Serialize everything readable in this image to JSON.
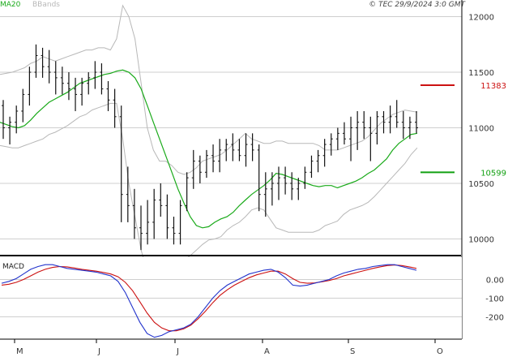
{
  "header": {
    "ma_label": "MA20",
    "bbands_label": "BBands",
    "copyright": "© TEC 29/9/2024 3:0 GMT"
  },
  "colors": {
    "ma": "#1aaa1a",
    "bands": "#b8b8b8",
    "price_bars": "#111111",
    "resistance": "#cc1111",
    "support": "#11a011",
    "macd": "#2233cc",
    "signal": "#cc1111",
    "grid": "#cfcfcf"
  },
  "chart_data": [
    {
      "type": "line",
      "title": "",
      "x_ticks": [
        "M",
        "J",
        "J",
        "A",
        "S",
        "O"
      ],
      "ylim": [
        9850,
        12150
      ],
      "y_ticks": [
        10000,
        10500,
        11000,
        11500,
        12000
      ],
      "grid": true,
      "ohlc_series_name": "price_bars",
      "series": [
        {
          "name": "MA20",
          "values": [
            11050,
            11030,
            11010,
            11000,
            11020,
            11070,
            11130,
            11180,
            11230,
            11260,
            11290,
            11320,
            11360,
            11400,
            11420,
            11440,
            11460,
            11480,
            11490,
            11510,
            11520,
            11500,
            11450,
            11350,
            11200,
            11050,
            10900,
            10750,
            10600,
            10450,
            10320,
            10200,
            10120,
            10100,
            10110,
            10150,
            10180,
            10200,
            10240,
            10300,
            10350,
            10400,
            10440,
            10480,
            10530,
            10590,
            10580,
            10560,
            10540,
            10520,
            10500,
            10480,
            10470,
            10480,
            10480,
            10460,
            10480,
            10500,
            10520,
            10550,
            10590,
            10620,
            10670,
            10720,
            10800,
            10860,
            10900,
            10940,
            10950
          ]
        },
        {
          "name": "BBands upper",
          "values": [
            11480,
            11490,
            11500,
            11520,
            11540,
            11580,
            11600,
            11640,
            11620,
            11600,
            11620,
            11640,
            11660,
            11680,
            11700,
            11700,
            11720,
            11720,
            11700,
            11800,
            12100,
            12000,
            11800,
            11400,
            11000,
            10800,
            10700,
            10700,
            10660,
            10600,
            10580,
            10600,
            10640,
            10700,
            10720,
            10740,
            10760,
            10800,
            10850,
            10900,
            10950,
            10900,
            10880,
            10860,
            10860,
            10880,
            10880,
            10860,
            10860,
            10860,
            10860,
            10860,
            10840,
            10800,
            10800,
            10800,
            10820,
            10840,
            10860,
            10880,
            10920,
            10980,
            11040,
            11080,
            11120,
            11140,
            11160,
            11150,
            11140
          ]
        },
        {
          "name": "BBands lower",
          "values": [
            10840,
            10830,
            10820,
            10820,
            10840,
            10860,
            10880,
            10900,
            10940,
            10960,
            10990,
            11020,
            11060,
            11100,
            11120,
            11160,
            11180,
            11200,
            11220,
            11220,
            10900,
            10500,
            10200,
            9900,
            9700,
            9600,
            9600,
            9650,
            9700,
            9750,
            9800,
            9850,
            9900,
            9950,
            9990,
            10000,
            10020,
            10080,
            10120,
            10150,
            10200,
            10260,
            10280,
            10260,
            10180,
            10100,
            10080,
            10060,
            10060,
            10060,
            10060,
            10060,
            10080,
            10120,
            10140,
            10160,
            10220,
            10260,
            10280,
            10300,
            10330,
            10380,
            10440,
            10500,
            10560,
            10620,
            10680,
            10760,
            10820
          ]
        },
        {
          "name": "price_bars",
          "ohlc": [
            [
              11200,
              11250,
              10900,
              11000
            ],
            [
              11000,
              11100,
              10850,
              11050
            ],
            [
              11050,
              11200,
              10950,
              11150
            ],
            [
              11150,
              11350,
              11050,
              11300
            ],
            [
              11300,
              11550,
              11200,
              11500
            ],
            [
              11500,
              11750,
              11450,
              11650
            ],
            [
              11650,
              11720,
              11450,
              11550
            ],
            [
              11550,
              11700,
              11400,
              11500
            ],
            [
              11500,
              11600,
              11300,
              11450
            ],
            [
              11450,
              11550,
              11300,
              11400
            ],
            [
              11400,
              11500,
              11250,
              11350
            ],
            [
              11350,
              11450,
              11150,
              11300
            ],
            [
              11300,
              11450,
              11200,
              11400
            ],
            [
              11400,
              11500,
              11300,
              11450
            ],
            [
              11450,
              11600,
              11350,
              11500
            ],
            [
              11500,
              11580,
              11300,
              11350
            ],
            [
              11350,
              11420,
              11150,
              11250
            ],
            [
              11250,
              11350,
              11000,
              11100
            ],
            [
              11100,
              11200,
              10150,
              10400
            ],
            [
              10400,
              10650,
              10150,
              10300
            ],
            [
              10300,
              10450,
              10000,
              10100
            ],
            [
              10100,
              10300,
              9900,
              10050
            ],
            [
              10050,
              10350,
              9950,
              10150
            ],
            [
              10150,
              10450,
              10000,
              10350
            ],
            [
              10350,
              10500,
              10200,
              10300
            ],
            [
              10300,
              10400,
              10000,
              10100
            ],
            [
              10100,
              10200,
              9950,
              10050
            ],
            [
              10050,
              10350,
              9950,
              10300
            ],
            [
              10300,
              10600,
              10250,
              10550
            ],
            [
              10550,
              10800,
              10450,
              10700
            ],
            [
              10700,
              10750,
              10500,
              10600
            ],
            [
              10600,
              10800,
              10550,
              10750
            ],
            [
              10750,
              10850,
              10600,
              10700
            ],
            [
              10700,
              10900,
              10600,
              10800
            ],
            [
              10800,
              10900,
              10700,
              10850
            ],
            [
              10850,
              10950,
              10700,
              10800
            ],
            [
              10800,
              10900,
              10700,
              10750
            ],
            [
              10750,
              10950,
              10650,
              10850
            ],
            [
              10850,
              10950,
              10700,
              10800
            ],
            [
              10800,
              10850,
              10250,
              10400
            ],
            [
              10400,
              10600,
              10200,
              10450
            ],
            [
              10450,
              10600,
              10300,
              10500
            ],
            [
              10500,
              10650,
              10350,
              10550
            ],
            [
              10550,
              10650,
              10400,
              10500
            ],
            [
              10500,
              10600,
              10350,
              10450
            ],
            [
              10450,
              10550,
              10350,
              10500
            ],
            [
              10500,
              10650,
              10450,
              10600
            ],
            [
              10600,
              10750,
              10550,
              10700
            ],
            [
              10700,
              10800,
              10600,
              10750
            ],
            [
              10750,
              10900,
              10650,
              10850
            ],
            [
              10850,
              10950,
              10750,
              10900
            ],
            [
              10900,
              11000,
              10800,
              10950
            ],
            [
              10950,
              11050,
              10850,
              10900
            ],
            [
              10900,
              11100,
              10700,
              11000
            ],
            [
              11000,
              11150,
              10800,
              11050
            ],
            [
              11050,
              11150,
              10900,
              11000
            ],
            [
              11000,
              11100,
              10700,
              10950
            ],
            [
              10950,
              11150,
              10850,
              11100
            ],
            [
              11100,
              11150,
              10950,
              11050
            ],
            [
              11050,
              11200,
              10950,
              11100
            ],
            [
              11100,
              11250,
              11000,
              11050
            ],
            [
              11050,
              11150,
              10900,
              11000
            ],
            [
              11000,
              11100,
              10900,
              11050
            ],
            [
              11050,
              11150,
              10950,
              11000
            ]
          ]
        }
      ],
      "annotations": [
        {
          "name": "resistance",
          "value": 11383,
          "label": "11383"
        },
        {
          "name": "support",
          "value": 10599,
          "label": "10599"
        }
      ]
    },
    {
      "type": "line",
      "title": "MACD",
      "ylim": [
        -320,
        120
      ],
      "y_ticks": [
        0,
        -200
      ],
      "y_tick_labels": [
        "0.00",
        "-200"
      ],
      "y_minor_ticks": [
        -100
      ],
      "y_minor_tick_labels": [
        "-100"
      ],
      "grid": true,
      "series": [
        {
          "name": "MACD",
          "values": [
            -20,
            -10,
            5,
            30,
            55,
            70,
            80,
            80,
            70,
            60,
            55,
            50,
            45,
            40,
            30,
            20,
            -10,
            -70,
            -150,
            -230,
            -290,
            -310,
            -300,
            -280,
            -270,
            -260,
            -240,
            -200,
            -150,
            -100,
            -60,
            -30,
            -10,
            10,
            30,
            40,
            50,
            55,
            40,
            10,
            -30,
            -35,
            -30,
            -20,
            -10,
            0,
            20,
            35,
            45,
            55,
            60,
            70,
            75,
            80,
            80,
            70,
            60,
            50
          ]
        },
        {
          "name": "Signal",
          "values": [
            -30,
            -25,
            -15,
            0,
            20,
            40,
            55,
            65,
            70,
            68,
            62,
            55,
            50,
            45,
            38,
            30,
            15,
            -15,
            -60,
            -120,
            -180,
            -230,
            -260,
            -275,
            -275,
            -265,
            -245,
            -210,
            -170,
            -125,
            -85,
            -55,
            -30,
            -10,
            10,
            25,
            35,
            45,
            45,
            30,
            5,
            -15,
            -20,
            -18,
            -12,
            -5,
            5,
            20,
            30,
            40,
            50,
            60,
            68,
            75,
            78,
            75,
            68,
            60
          ]
        }
      ]
    }
  ]
}
